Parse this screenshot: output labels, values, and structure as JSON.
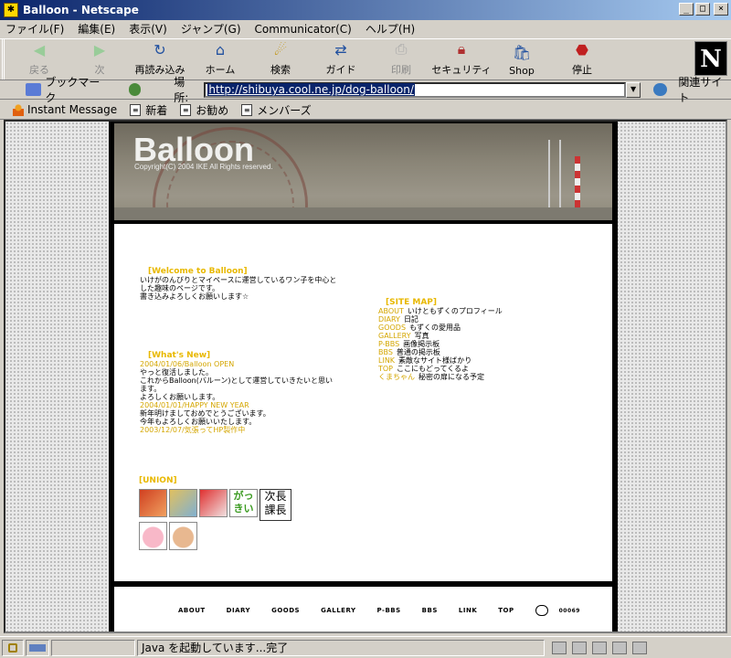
{
  "window": {
    "title": "Balloon - Netscape",
    "minimize": "_",
    "maximize": "□",
    "close": "×"
  },
  "menu": [
    "ファイル(F)",
    "編集(E)",
    "表示(V)",
    "ジャンプ(G)",
    "Communicator(C)",
    "ヘルプ(H)"
  ],
  "nav": [
    {
      "label": "戻る",
      "icon": "back-arrow-icon",
      "enabled": false
    },
    {
      "label": "次",
      "icon": "forward-arrow-icon",
      "enabled": false
    },
    {
      "label": "再読み込み",
      "icon": "reload-icon",
      "enabled": true
    },
    {
      "label": "ホーム",
      "icon": "home-icon",
      "enabled": true
    },
    {
      "label": "検索",
      "icon": "search-icon",
      "enabled": true
    },
    {
      "label": "ガイド",
      "icon": "guide-icon",
      "enabled": true
    },
    {
      "label": "印刷",
      "icon": "print-icon",
      "enabled": false
    },
    {
      "label": "セキュリティ",
      "icon": "security-lock-icon",
      "enabled": true
    },
    {
      "label": "Shop",
      "icon": "shop-icon",
      "enabled": true
    },
    {
      "label": "停止",
      "icon": "stop-icon",
      "enabled": true
    }
  ],
  "netscape_logo": "N",
  "location": {
    "bookmarks": "ブックマーク",
    "label": "場所:",
    "url": "http://shibuya.cool.ne.jp/dog-balloon/",
    "related": "関連サイト"
  },
  "personal_bar": [
    "Instant Message",
    "新着",
    "お勧め",
    "メンバーズ"
  ],
  "page": {
    "brand": "Balloon",
    "copyright": "Copyright(C) 2004 IKE All Rights reserved.",
    "welcome": {
      "title": "[Welcome to Balloon]",
      "lines": [
        "いけがのんびりとマイペースに運営しているワン子を中心と",
        "した趣味のページです。",
        "書き込みよろしくお願いします☆"
      ]
    },
    "news": {
      "title": "[What's New]",
      "entries": [
        {
          "date": "2004/01/06/Balloon OPEN",
          "lines": [
            "やっと復活しました。",
            "これからBalloon(バルーン)として運営していきたいと思い",
            "ます。",
            "よろしくお願いします。"
          ]
        },
        {
          "date": "2004/01/01/HAPPY NEW YEAR",
          "lines": [
            "新年明けましておめでとうございます。",
            "今年もよろしくお願いいたします。"
          ]
        },
        {
          "date": "2003/12/07/気張ってHP製作中",
          "lines": []
        }
      ]
    },
    "sitemap": {
      "title": "[SITE MAP]",
      "items": [
        {
          "key": "ABOUT",
          "desc": "いけともずくのプロフィール"
        },
        {
          "key": "DIARY",
          "desc": "日記"
        },
        {
          "key": "GOODS",
          "desc": "もずくの愛用品"
        },
        {
          "key": "GALLERY",
          "desc": "写真"
        },
        {
          "key": "P-BBS",
          "desc": "画像掲示板"
        },
        {
          "key": "BBS",
          "desc": "普通の掲示板"
        },
        {
          "key": "LINK",
          "desc": "素敵なサイト様ばかり"
        },
        {
          "key": "TOP",
          "desc": "ここにもどってくるよ"
        },
        {
          "key": "くまちゃん",
          "desc": "秘密の扉になる予定"
        }
      ]
    },
    "union": {
      "title": "[UNION]",
      "banner_texts": [
        "がっきい",
        "次長課長"
      ]
    },
    "footer_nav": [
      "ABOUT",
      "DIARY",
      "GOODS",
      "GALLERY",
      "P-BBS",
      "BBS",
      "LINK",
      "TOP"
    ],
    "footer_counter": "00069"
  },
  "status": {
    "text": "Java を起動しています...完了"
  }
}
